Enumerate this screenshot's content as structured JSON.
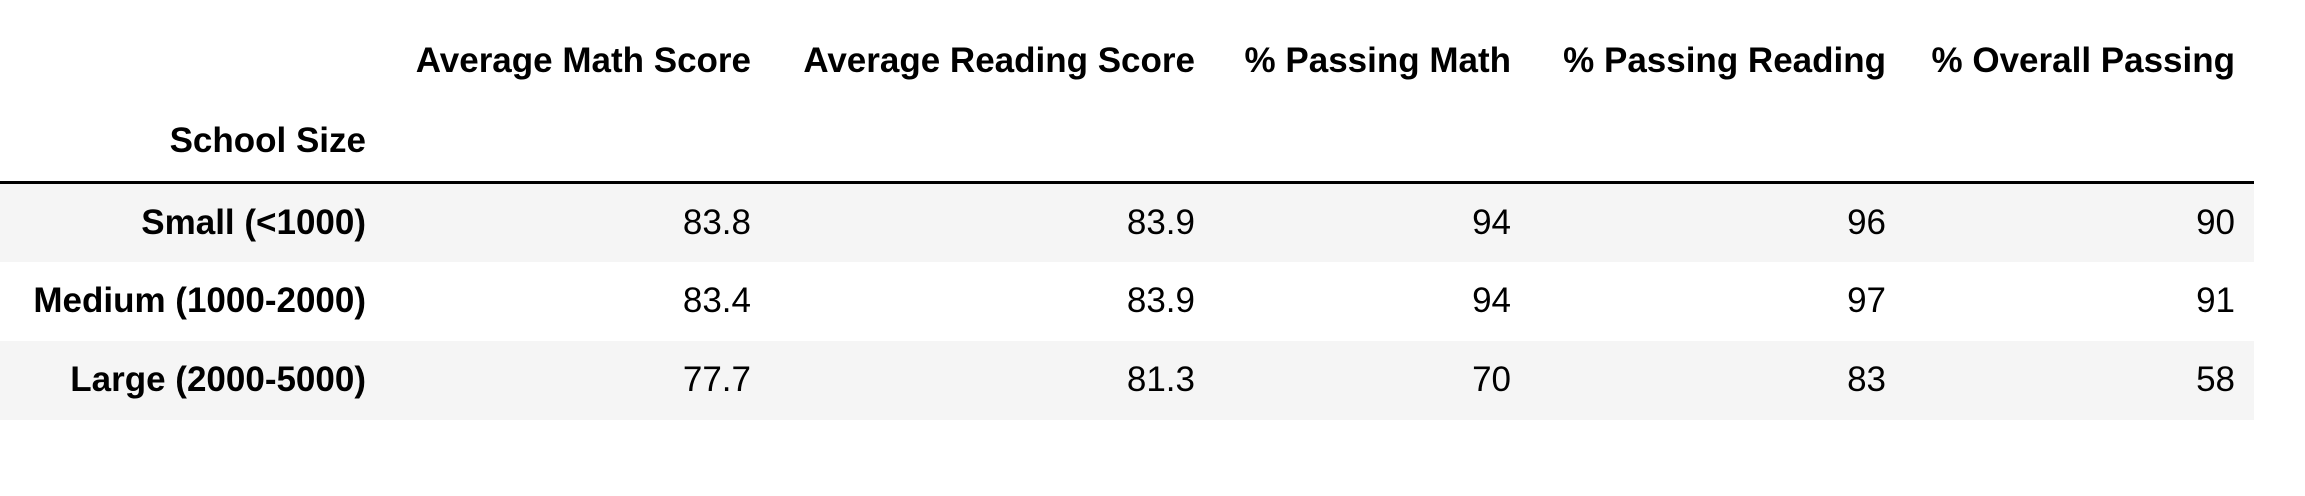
{
  "table": {
    "columns": [
      "Average Math Score",
      "Average Reading Score",
      "% Passing Math",
      "% Passing Reading",
      "% Overall Passing"
    ],
    "index_name": "School Size",
    "rows": [
      {
        "label": "Small (<1000)",
        "values": [
          "83.8",
          "83.9",
          "94",
          "96",
          "90"
        ]
      },
      {
        "label": "Medium (1000-2000)",
        "values": [
          "83.4",
          "83.9",
          "94",
          "97",
          "91"
        ]
      },
      {
        "label": "Large (2000-5000)",
        "values": [
          "77.7",
          "81.3",
          "70",
          "83",
          "58"
        ]
      }
    ]
  },
  "colors": {
    "row_stripe": "#f5f5f5",
    "rule": "#000000",
    "text": "#000000"
  }
}
